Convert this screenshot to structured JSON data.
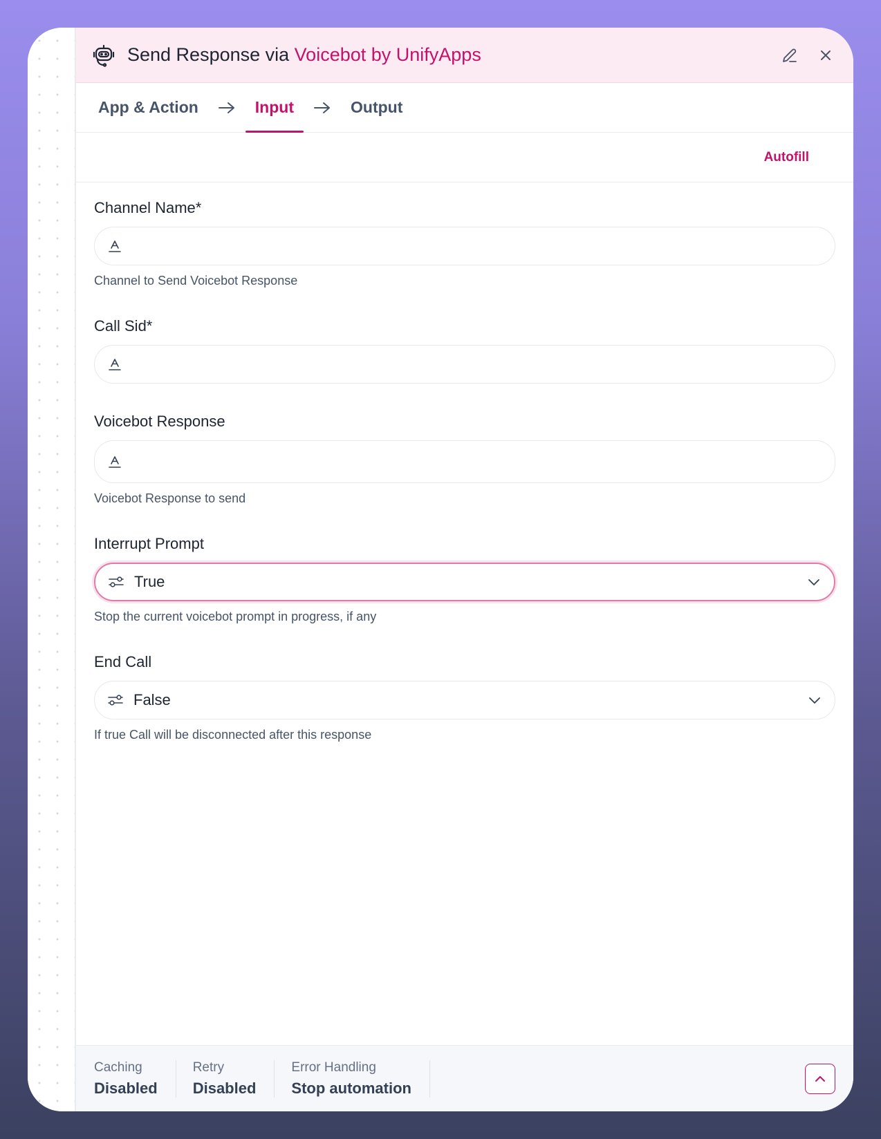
{
  "header": {
    "title_prefix": "Send Response via ",
    "title_app": "Voicebot by UnifyApps",
    "app_icon": "robot-headset-icon",
    "edit_icon": "pencil-icon",
    "close_icon": "close-icon"
  },
  "steps": [
    {
      "label": "App & Action"
    },
    {
      "label": "Input"
    },
    {
      "label": "Output"
    }
  ],
  "toolbar": {
    "autofill_label": "Autofill"
  },
  "fields": [
    {
      "label": "Channel Name*",
      "value": "",
      "hint": "Channel to Send Voicebot Response"
    },
    {
      "label": "Call Sid*",
      "value": ""
    },
    {
      "label": "Voicebot Response",
      "value": "",
      "hint": "Voicebot Response to send"
    },
    {
      "label": "Interrupt Prompt",
      "value": "True",
      "hint": "Stop the current voicebot prompt in progress, if any"
    },
    {
      "label": "End Call",
      "value": "False",
      "hint": "If true Call will be disconnected after this response"
    }
  ],
  "footer": {
    "caching_label": "Caching",
    "caching_value": "Disabled",
    "retry_label": "Retry",
    "retry_value": "Disabled",
    "error_label": "Error Handling",
    "error_value": "Stop automation"
  },
  "colors": {
    "accent": "#c4126a",
    "header_bg": "#fdebf3"
  }
}
